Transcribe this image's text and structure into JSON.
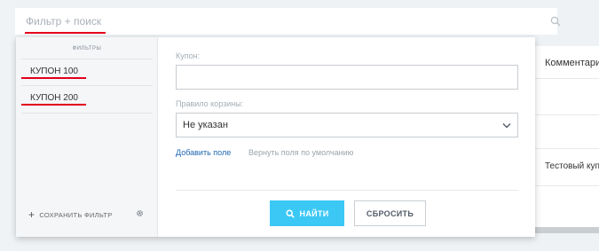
{
  "search": {
    "placeholder": "Фильтр + поиск"
  },
  "background_table": {
    "column_header": "Комментари",
    "cell_text": "Тестовый куп"
  },
  "filter_popup": {
    "sidebar": {
      "title": "ФИЛЬТРЫ",
      "presets": [
        "КУПОН 100",
        "КУПОН 200"
      ],
      "save_filter_label": "СОХРАНИТЬ ФИЛЬТР"
    },
    "fields": {
      "coupon_label": "Купон:",
      "coupon_value": "",
      "cart_rule_label": "Правило корзины:",
      "cart_rule_value": "Не указан"
    },
    "links": {
      "add_field": "Добавить поле",
      "reset_fields": "Вернуть поля по умолчанию"
    },
    "buttons": {
      "find": "НАЙТИ",
      "reset": "СБРОСИТЬ"
    }
  },
  "colors": {
    "accent": "#3bc8f5",
    "annotation_red": "#e3001b",
    "link": "#2067b0"
  },
  "icons": [
    "search-icon",
    "plus-icon",
    "gear-icon",
    "chevron-down-icon"
  ]
}
